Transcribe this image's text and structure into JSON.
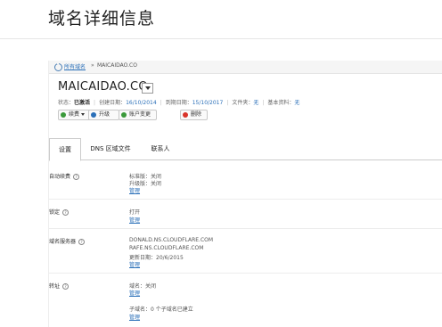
{
  "page": {
    "title": "域名详细信息"
  },
  "breadcrumb": {
    "root": "所有域名",
    "separator": "»",
    "current": "MAICAIDAO.CO"
  },
  "domain": {
    "name": "MAICAIDAO.CO"
  },
  "status": {
    "status_label": "状态：",
    "status_value": "已激活",
    "created_label": "创建日期：",
    "created_value": "16/10/2014",
    "expires_label": "到期日期：",
    "expires_value": "15/10/2017",
    "folder_label": "文件夹：",
    "folder_value": "无",
    "profile_label": "基本资料：",
    "profile_value": "无"
  },
  "actions": {
    "renew": "续费",
    "upgrade": "升级",
    "account_change": "账户变更",
    "delete": "删除"
  },
  "tabs": [
    {
      "label": "设置"
    },
    {
      "label": "DNS 区域文件"
    },
    {
      "label": "联系人"
    }
  ],
  "settings": {
    "auto_renew": {
      "label": "自动续费",
      "line1": "标准版：关闭",
      "line2": "升级版：关闭",
      "link": "管理"
    },
    "lock": {
      "label": "锁定",
      "value": "打开",
      "link": "管理"
    },
    "nameservers": {
      "label": "域名服务器",
      "ns1": "DONALD.NS.CLOUDFLARE.COM",
      "ns2": "RAFE.NS.CLOUDFLARE.COM",
      "updated": "更新日期：20/6/2015",
      "link": "管理"
    },
    "forwarding": {
      "label": "转址",
      "domain_line": "域名：关闭",
      "link": "管理",
      "subdomain_line": "子域名：0 个子域名已建立",
      "sub_link": "管理"
    }
  },
  "colors": {
    "link": "#2a6fb8",
    "renew_icon": "#3b9a3b",
    "upgrade_icon": "#2a6fb8",
    "account_icon": "#3b9a3b",
    "delete_icon": "#d9342b"
  }
}
